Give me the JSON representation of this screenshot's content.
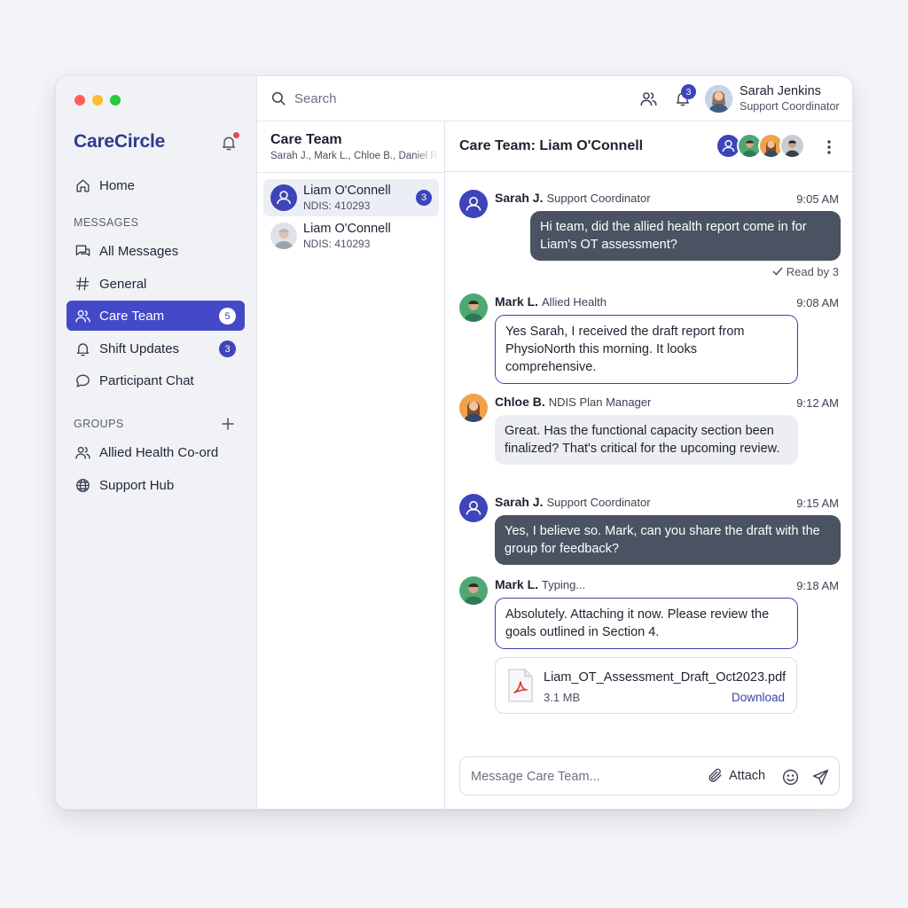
{
  "app": {
    "brand": "CareCircle"
  },
  "colors": {
    "accent": "#4449c9",
    "badge": "#3d45b8",
    "dark_bubble": "#4b5262"
  },
  "sidebar": {
    "home_label": "Home",
    "messages_heading": "MESSAGES",
    "items": [
      {
        "label": "All Messages",
        "icon": "chat-bubbles-icon"
      },
      {
        "label": "General",
        "icon": "hash-icon"
      },
      {
        "label": "Care Team",
        "icon": "people-icon",
        "badge": "5",
        "active": true
      },
      {
        "label": "Shift Updates",
        "icon": "bell-icon",
        "badge": "3"
      },
      {
        "label": "Participant Chat",
        "icon": "chat-bubble-icon"
      }
    ],
    "groups_heading": "GROUPS",
    "groups": [
      {
        "label": "Allied Health Co-ord",
        "icon": "people-icon"
      },
      {
        "label": "Support Hub",
        "icon": "globe-icon"
      }
    ]
  },
  "topbar": {
    "search_placeholder": "Search",
    "notification_count": "3",
    "user_name": "Sarah Jenkins",
    "user_role": "Support Coordinator"
  },
  "conversation_list": {
    "title": "Care Team",
    "members": "Sarah J., Mark L., Chloe B., Daniel R.",
    "items": [
      {
        "name": "Liam O'Connell",
        "sub": "NDIS: 410293",
        "badge": "3",
        "selected": true
      },
      {
        "name": "Liam O'Connell",
        "sub": "NDIS: 410293"
      }
    ]
  },
  "chat": {
    "title": "Care Team: Liam O'Connell",
    "messages": [
      {
        "name": "Sarah J.",
        "role": "Support Coordinator",
        "time": "9:05 AM",
        "text": "Hi team, did the allied health report come in for Liam's OT assessment?",
        "read_receipt": "Read by 3"
      },
      {
        "name": "Mark L.",
        "role": "Allied Health",
        "time": "9:08 AM",
        "text": "Yes Sarah, I received the draft report from PhysioNorth this morning. It looks comprehensive."
      },
      {
        "name": "Chloe B.",
        "role": "NDIS Plan Manager",
        "time": "9:12 AM",
        "text": "Great. Has the functional capacity section been finalized? That's critical for the upcoming review."
      },
      {
        "name": "Sarah J.",
        "role": "Support Coordinator",
        "time": "9:15 AM",
        "text": "Yes, I believe so. Mark, can you share the draft with the group for feedback?"
      },
      {
        "name": "Mark L.",
        "role": "Typing...",
        "time": "9:18 AM",
        "text": "Absolutely. Attaching it now. Please review the goals outlined in Section 4."
      }
    ],
    "attachment": {
      "file_name": "Liam_OT_Assessment_Draft_Oct2023.pdf",
      "size": "3.1 MB",
      "action": "Download",
      "icon": "pdf-icon"
    },
    "composer": {
      "placeholder": "Message Care Team...",
      "attach_label": "Attach"
    }
  }
}
